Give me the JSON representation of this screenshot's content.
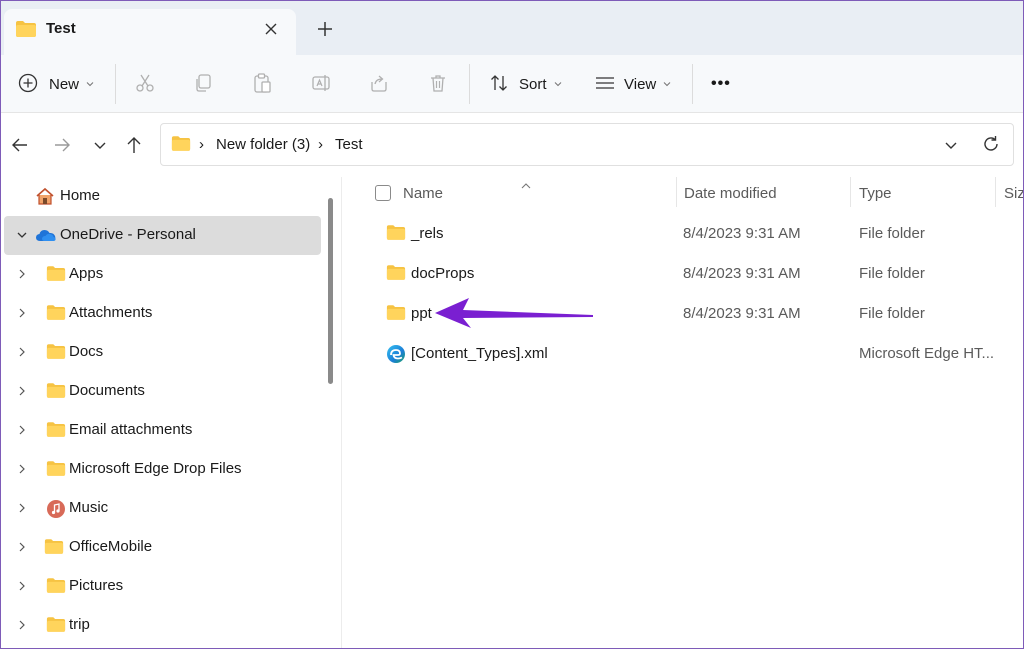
{
  "tab": {
    "title": "Test"
  },
  "toolbar": {
    "new_label": "New",
    "sort_label": "Sort",
    "view_label": "View",
    "more": "•••"
  },
  "breadcrumb": {
    "items": [
      "New folder (3)",
      "Test"
    ],
    "separator": "›"
  },
  "sidebar": {
    "items": [
      {
        "label": "Home",
        "icon": "home-icon"
      },
      {
        "label": "OneDrive - Personal",
        "icon": "onedrive-icon",
        "selected": true,
        "expanded": true
      },
      {
        "label": "Apps",
        "icon": "folder-icon"
      },
      {
        "label": "Attachments",
        "icon": "folder-icon"
      },
      {
        "label": "Docs",
        "icon": "folder-icon"
      },
      {
        "label": "Documents",
        "icon": "folder-icon"
      },
      {
        "label": "Email attachments",
        "icon": "folder-icon"
      },
      {
        "label": "Microsoft Edge Drop Files",
        "icon": "folder-icon"
      },
      {
        "label": "Music",
        "icon": "music-icon"
      },
      {
        "label": "OfficeMobile",
        "icon": "folder-icon"
      },
      {
        "label": "Pictures",
        "icon": "folder-icon"
      },
      {
        "label": "trip",
        "icon": "folder-icon"
      }
    ]
  },
  "columns": {
    "name": "Name",
    "date": "Date modified",
    "type": "Type",
    "size": "Siz"
  },
  "files": [
    {
      "name": "_rels",
      "date": "8/4/2023 9:31 AM",
      "type": "File folder",
      "icon": "folder-icon"
    },
    {
      "name": "docProps",
      "date": "8/4/2023 9:31 AM",
      "type": "File folder",
      "icon": "folder-icon"
    },
    {
      "name": "ppt",
      "date": "8/4/2023 9:31 AM",
      "type": "File folder",
      "icon": "folder-icon"
    },
    {
      "name": "[Content_Types].xml",
      "date": "",
      "type": "Microsoft Edge HT...",
      "icon": "edge-icon"
    }
  ],
  "colors": {
    "accent_arrow": "#7a1fd1",
    "folder": "#f6c343",
    "selected_bg": "#dcdcdc"
  }
}
